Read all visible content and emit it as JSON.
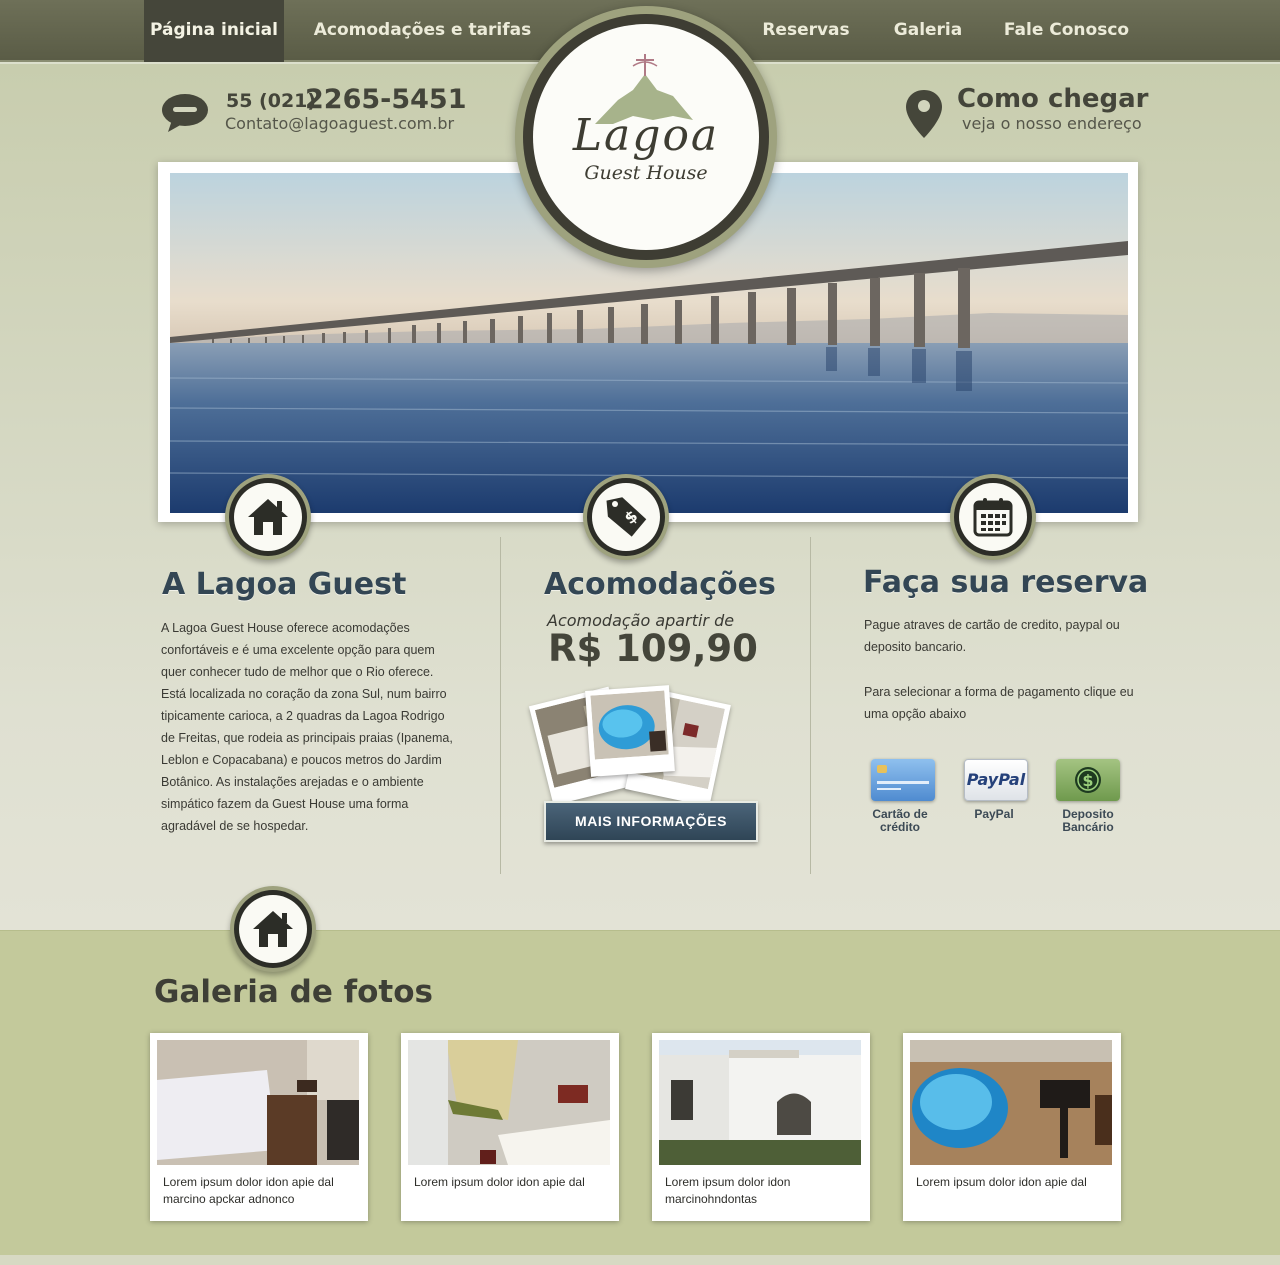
{
  "nav": {
    "items": [
      {
        "label": "Página inicial",
        "active": true
      },
      {
        "label": "Acomodações e tarifas"
      },
      {
        "label": "Reservas"
      },
      {
        "label": "Galeria"
      },
      {
        "label": "Fale Conosco"
      }
    ]
  },
  "logo": {
    "name": "Lagoa",
    "sub": "Guest House"
  },
  "contact": {
    "phone_prefix": "55 (021)",
    "phone_number": "2265-5451",
    "email": "Contato@lagoaguest.com.br",
    "icon": "speech-bubble-icon"
  },
  "directions": {
    "title": "Como chegar",
    "subtitle": "veja o nosso endereço",
    "icon": "map-pin-icon"
  },
  "about": {
    "title": "A Lagoa Guest",
    "text": "A Lagoa Guest House oferece acomodações confortáveis e é uma excelente opção para quem quer conhecer tudo de melhor que o Rio oferece. Está localizada no coração da zona Sul, num bairro tipicamente carioca, a 2 quadras da Lagoa Rodrigo de Freitas, que rodeia as principais praias (Ipanema, Leblon e Copacabana) e poucos metros do Jardim Botânico. As instalações arejadas e o ambiente simpático fazem da Guest House uma forma agradável de se hospedar.",
    "icon": "house-icon"
  },
  "accommodation": {
    "title": "Acomodações",
    "subtitle": "Acomodação apartir  de",
    "price": "R$ 109,90",
    "button": "MAIS INFORMAÇÕES",
    "icon": "price-tag-icon"
  },
  "reservation": {
    "title": "Faça sua reserva",
    "text1": "Pague atraves de cartão de credito, paypal ou deposito bancario.",
    "text2": "Para selecionar a forma de pagamento clique eu uma opção abaixo",
    "icon": "calendar-icon",
    "payments": [
      {
        "line1": "Cartão de",
        "line2": "crédito",
        "icon": "credit-card-icon"
      },
      {
        "line1": "PayPal",
        "line2": "",
        "icon": "paypal-icon",
        "logo_text": "PayPal"
      },
      {
        "line1": "Deposito",
        "line2": "Bancário",
        "icon": "dollar-icon"
      }
    ]
  },
  "gallery": {
    "title": "Galeria de fotos",
    "icon": "house-icon",
    "cards": [
      {
        "caption": "Lorem ipsum dolor idon apie dal marcino apckar adnonco"
      },
      {
        "caption": "Lorem ipsum dolor idon apie dal"
      },
      {
        "caption": "Lorem ipsum dolor idon marcinohndontas"
      },
      {
        "caption": "Lorem ipsum dolor idon apie dal"
      }
    ]
  },
  "colors": {
    "nav_bg": "#5f614b",
    "nav_active": "#45463a",
    "title": "#334654",
    "button": "#3d5568",
    "gallery_band": "#c3c99b"
  }
}
